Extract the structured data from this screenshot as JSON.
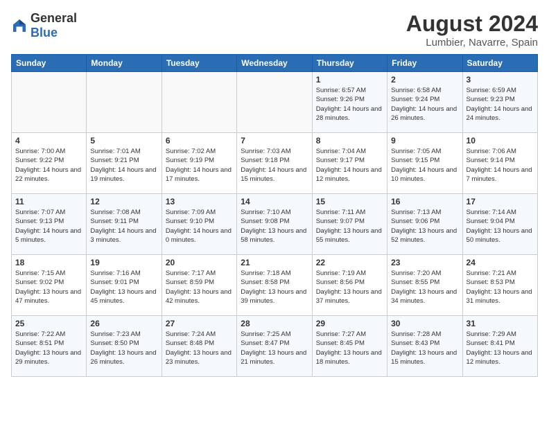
{
  "logo": {
    "general": "General",
    "blue": "Blue"
  },
  "header": {
    "month_year": "August 2024",
    "location": "Lumbier, Navarre, Spain"
  },
  "weekdays": [
    "Sunday",
    "Monday",
    "Tuesday",
    "Wednesday",
    "Thursday",
    "Friday",
    "Saturday"
  ],
  "weeks": [
    [
      {
        "day": "",
        "info": ""
      },
      {
        "day": "",
        "info": ""
      },
      {
        "day": "",
        "info": ""
      },
      {
        "day": "",
        "info": ""
      },
      {
        "day": "1",
        "info": "Sunrise: 6:57 AM\nSunset: 9:26 PM\nDaylight: 14 hours and 28 minutes."
      },
      {
        "day": "2",
        "info": "Sunrise: 6:58 AM\nSunset: 9:24 PM\nDaylight: 14 hours and 26 minutes."
      },
      {
        "day": "3",
        "info": "Sunrise: 6:59 AM\nSunset: 9:23 PM\nDaylight: 14 hours and 24 minutes."
      }
    ],
    [
      {
        "day": "4",
        "info": "Sunrise: 7:00 AM\nSunset: 9:22 PM\nDaylight: 14 hours and 22 minutes."
      },
      {
        "day": "5",
        "info": "Sunrise: 7:01 AM\nSunset: 9:21 PM\nDaylight: 14 hours and 19 minutes."
      },
      {
        "day": "6",
        "info": "Sunrise: 7:02 AM\nSunset: 9:19 PM\nDaylight: 14 hours and 17 minutes."
      },
      {
        "day": "7",
        "info": "Sunrise: 7:03 AM\nSunset: 9:18 PM\nDaylight: 14 hours and 15 minutes."
      },
      {
        "day": "8",
        "info": "Sunrise: 7:04 AM\nSunset: 9:17 PM\nDaylight: 14 hours and 12 minutes."
      },
      {
        "day": "9",
        "info": "Sunrise: 7:05 AM\nSunset: 9:15 PM\nDaylight: 14 hours and 10 minutes."
      },
      {
        "day": "10",
        "info": "Sunrise: 7:06 AM\nSunset: 9:14 PM\nDaylight: 14 hours and 7 minutes."
      }
    ],
    [
      {
        "day": "11",
        "info": "Sunrise: 7:07 AM\nSunset: 9:13 PM\nDaylight: 14 hours and 5 minutes."
      },
      {
        "day": "12",
        "info": "Sunrise: 7:08 AM\nSunset: 9:11 PM\nDaylight: 14 hours and 3 minutes."
      },
      {
        "day": "13",
        "info": "Sunrise: 7:09 AM\nSunset: 9:10 PM\nDaylight: 14 hours and 0 minutes."
      },
      {
        "day": "14",
        "info": "Sunrise: 7:10 AM\nSunset: 9:08 PM\nDaylight: 13 hours and 58 minutes."
      },
      {
        "day": "15",
        "info": "Sunrise: 7:11 AM\nSunset: 9:07 PM\nDaylight: 13 hours and 55 minutes."
      },
      {
        "day": "16",
        "info": "Sunrise: 7:13 AM\nSunset: 9:06 PM\nDaylight: 13 hours and 52 minutes."
      },
      {
        "day": "17",
        "info": "Sunrise: 7:14 AM\nSunset: 9:04 PM\nDaylight: 13 hours and 50 minutes."
      }
    ],
    [
      {
        "day": "18",
        "info": "Sunrise: 7:15 AM\nSunset: 9:02 PM\nDaylight: 13 hours and 47 minutes."
      },
      {
        "day": "19",
        "info": "Sunrise: 7:16 AM\nSunset: 9:01 PM\nDaylight: 13 hours and 45 minutes."
      },
      {
        "day": "20",
        "info": "Sunrise: 7:17 AM\nSunset: 8:59 PM\nDaylight: 13 hours and 42 minutes."
      },
      {
        "day": "21",
        "info": "Sunrise: 7:18 AM\nSunset: 8:58 PM\nDaylight: 13 hours and 39 minutes."
      },
      {
        "day": "22",
        "info": "Sunrise: 7:19 AM\nSunset: 8:56 PM\nDaylight: 13 hours and 37 minutes."
      },
      {
        "day": "23",
        "info": "Sunrise: 7:20 AM\nSunset: 8:55 PM\nDaylight: 13 hours and 34 minutes."
      },
      {
        "day": "24",
        "info": "Sunrise: 7:21 AM\nSunset: 8:53 PM\nDaylight: 13 hours and 31 minutes."
      }
    ],
    [
      {
        "day": "25",
        "info": "Sunrise: 7:22 AM\nSunset: 8:51 PM\nDaylight: 13 hours and 29 minutes."
      },
      {
        "day": "26",
        "info": "Sunrise: 7:23 AM\nSunset: 8:50 PM\nDaylight: 13 hours and 26 minutes."
      },
      {
        "day": "27",
        "info": "Sunrise: 7:24 AM\nSunset: 8:48 PM\nDaylight: 13 hours and 23 minutes."
      },
      {
        "day": "28",
        "info": "Sunrise: 7:25 AM\nSunset: 8:47 PM\nDaylight: 13 hours and 21 minutes."
      },
      {
        "day": "29",
        "info": "Sunrise: 7:27 AM\nSunset: 8:45 PM\nDaylight: 13 hours and 18 minutes."
      },
      {
        "day": "30",
        "info": "Sunrise: 7:28 AM\nSunset: 8:43 PM\nDaylight: 13 hours and 15 minutes."
      },
      {
        "day": "31",
        "info": "Sunrise: 7:29 AM\nSunset: 8:41 PM\nDaylight: 13 hours and 12 minutes."
      }
    ]
  ]
}
